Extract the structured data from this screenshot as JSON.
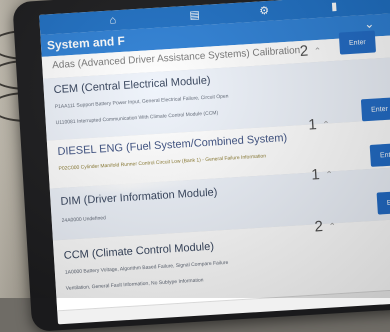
{
  "header": {
    "title": "System and F"
  },
  "rows": [
    {
      "name": "Adas (Advanced Driver Assistance Systems) Calibration",
      "count": "2",
      "enter_label": "Enter",
      "details": []
    },
    {
      "name": "CEM (Central Electrical Module)",
      "count": "",
      "enter_label": "",
      "details": [
        "P1AA111 Support Battery Power Input, General Electrical Failure, Circuit Open",
        "U110081 Interrupted Communication With Climate Control Module (CCM)"
      ]
    },
    {
      "name": "DIESEL ENG (Fuel System/Combined System)",
      "count": "1",
      "enter_label": "Enter",
      "details": [
        "P02C000 Cylinder Manifold Runner Control Circuit Low (Bank 1) - General Failure Information"
      ]
    },
    {
      "name": "DIM (Driver Information Module)",
      "count": "1",
      "enter_label": "Enter",
      "details": [
        "24A0000 Undefined"
      ]
    },
    {
      "name": "CCM (Climate Control Module)",
      "count": "2",
      "enter_label": "Enter",
      "details": [
        "1A0000 Battery Voltage, Algorithm Based Failure, Signal Compare Failure",
        "Ventilation, General Fault Information, No Subtype Information"
      ]
    }
  ],
  "colors": {
    "topbar": "#1d6fc4",
    "titlebar": "#2c7fd5",
    "button": "#1f6ac6",
    "row_background": "#ffffff"
  },
  "icons": [
    "home-icon",
    "report-icon",
    "settings-icon",
    "battery-icon",
    "chevron-down-icon"
  ]
}
